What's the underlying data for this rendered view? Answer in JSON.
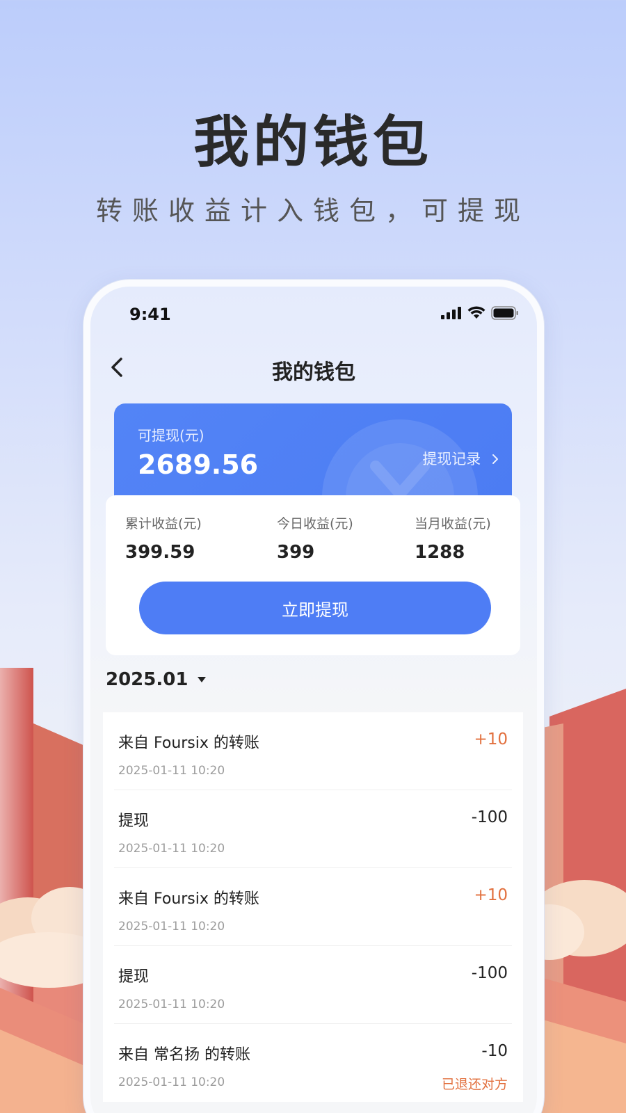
{
  "promo": {
    "title": "我的钱包",
    "subtitle": "转账收益计入钱包，可提现"
  },
  "status_bar": {
    "time": "9:41",
    "icons": [
      "signal-icon",
      "wifi-icon",
      "battery-icon"
    ]
  },
  "nav": {
    "title": "我的钱包",
    "back_icon": "chevron-left-icon"
  },
  "balance": {
    "label": "可提现(元)",
    "amount": "2689.56",
    "record_link": "提现记录",
    "record_icon": "chevron-right-icon",
    "watermark_icon": "yuan-coin-icon"
  },
  "stats": [
    {
      "label": "累计收益(元)",
      "value": "399.59"
    },
    {
      "label": "今日收益(元)",
      "value": "399"
    },
    {
      "label": "当月收益(元)",
      "value": "1288"
    }
  ],
  "withdraw_button": "立即提现",
  "month": {
    "value": "2025.01",
    "icon": "caret-down-icon"
  },
  "transactions": [
    {
      "title": "来自 Foursix 的转账",
      "date": "2025-01-11 10:20",
      "amount": "+10",
      "status": ""
    },
    {
      "title": "提现",
      "date": "2025-01-11 10:20",
      "amount": "-100",
      "status": ""
    },
    {
      "title": "来自 Foursix 的转账",
      "date": "2025-01-11 10:20",
      "amount": "+10",
      "status": ""
    },
    {
      "title": "提现",
      "date": "2025-01-11 10:20",
      "amount": "-100",
      "status": ""
    },
    {
      "title": "来自 常名扬 的转账",
      "date": "2025-01-11 10:20",
      "amount": "-10",
      "status": "已退还对方"
    }
  ],
  "colors": {
    "primary": "#4e7df5",
    "positive_amount": "#e2703e",
    "background_top": "#bccdfb"
  }
}
